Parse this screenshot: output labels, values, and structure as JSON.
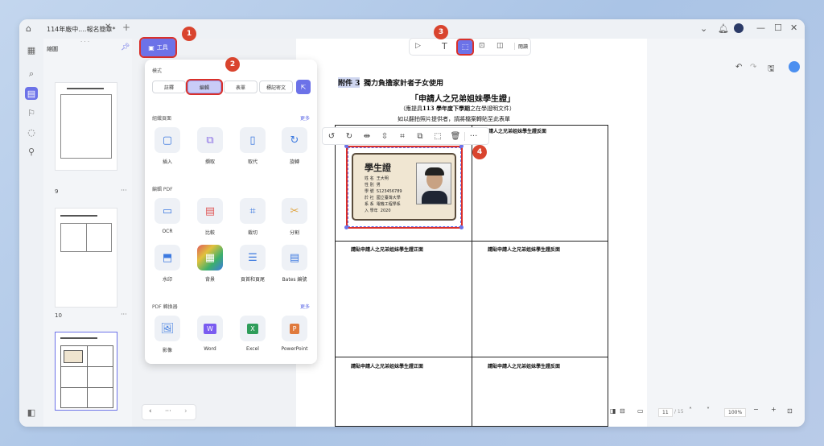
{
  "window": {
    "tab_title": "114年廠中....報名簡章*",
    "tab_close": "✕",
    "tab_add": "+"
  },
  "thumbnails": {
    "header": "縮圖",
    "pages": [
      {
        "num": "9",
        "more": "···"
      },
      {
        "num": "10",
        "more": "···"
      },
      {
        "num": "11",
        "more": "···"
      }
    ],
    "drag_dots": "· · ·"
  },
  "toolbar": {
    "tools_label": "工具",
    "view_label": "閱讀",
    "text_tool": "T",
    "cursor_tool": "▷"
  },
  "tools_panel": {
    "mode_header": "模式",
    "modes": [
      "註釋",
      "編輯",
      "表單",
      "標記密文"
    ],
    "selected_mode": "編輯",
    "organize_header": "組織頁面",
    "organize_more": "更多",
    "organize_tools": [
      "插入",
      "擷取",
      "取代",
      "旋轉"
    ],
    "edit_header": "編輯 PDF",
    "edit_tools_row1": [
      "OCR",
      "比較",
      "裁切",
      "分割"
    ],
    "edit_tools_row2": [
      "水印",
      "背景",
      "頁首和頁尾",
      "Bates 編號"
    ],
    "convert_header": "PDF 轉換器",
    "convert_more": "更多",
    "convert_tools": [
      "影像",
      "Word",
      "Excel",
      "PowerPoint"
    ]
  },
  "document": {
    "attachment_label": "附件 3",
    "line1_rest": "獨力負擔家計者子女使用",
    "title": "「申請人之兄弟姐妹學生證」",
    "subtitle_prefix": "（應提具",
    "subtitle_bold": "113 學年度下學期",
    "subtitle_suffix": "之在學證明文件）",
    "instruction": "如以翻拍照片提供者，請將檔案轉貼至此表單",
    "cell_back": "請貼申請人之兄弟姐妹學生證反面",
    "cell_front": "請貼申請人之兄弟姐妹學生證正面",
    "card": {
      "title": "學生證",
      "rows": [
        {
          "key": "姓 名",
          "value": "王大明"
        },
        {
          "key": "性 別",
          "value": "男"
        },
        {
          "key": "學 號",
          "value": "S123456789"
        },
        {
          "key": "於 社",
          "value": "國立臺灣大學"
        },
        {
          "key": "系 系",
          "value": "電機工程學系"
        },
        {
          "key": "入 學年",
          "value": "2020"
        }
      ]
    }
  },
  "status_bar": {
    "page_current": "11",
    "page_total": "/ 15",
    "zoom": "100%"
  },
  "callouts": [
    "1",
    "2",
    "3",
    "4"
  ],
  "colors": {
    "accent": "#6c72e8",
    "callout": "#d9442e",
    "highlight_red": "#d9302b"
  }
}
